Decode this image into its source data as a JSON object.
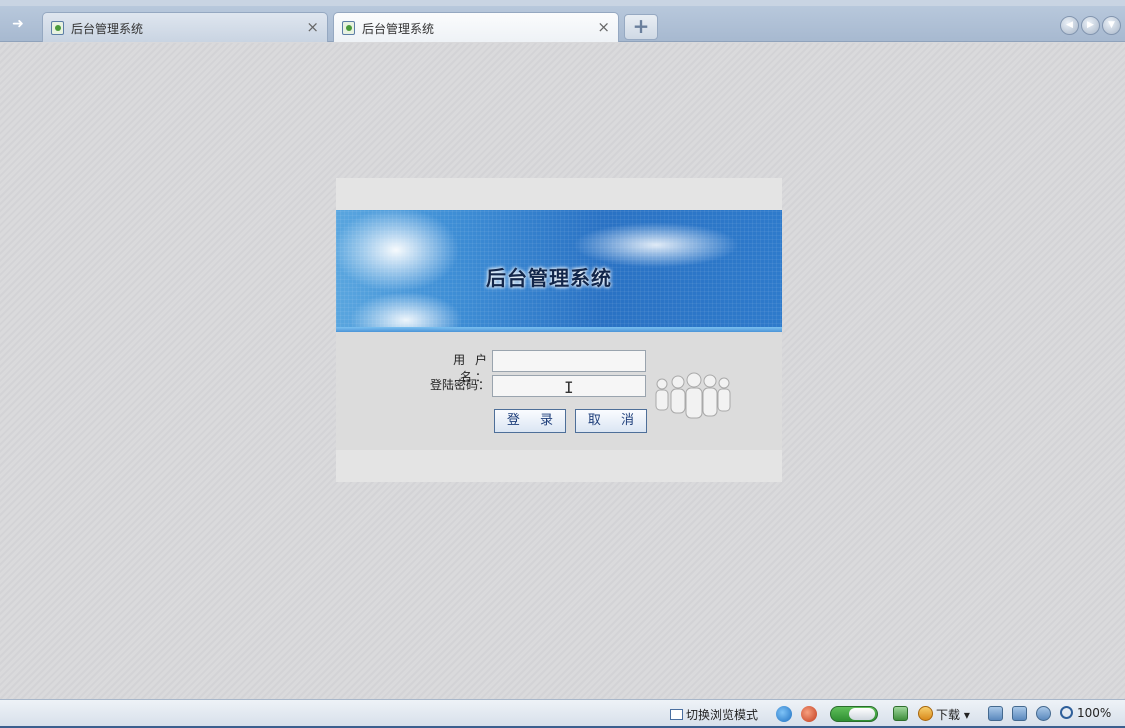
{
  "tabs": [
    {
      "label": "后台管理系统",
      "active": false
    },
    {
      "label": "后台管理系统",
      "active": true
    }
  ],
  "tab_close_glyph": "×",
  "new_tab_glyph": "+",
  "login": {
    "banner_title": "后台管理系统",
    "username_label": "用 户 名：",
    "password_label": "登陆密码：",
    "username_value": "",
    "password_value": "",
    "login_button": "登 录",
    "cancel_button": "取 消"
  },
  "statusbar": {
    "mode_switch": "切换浏览模式",
    "download": "下载 ▾",
    "zoom": "100%"
  },
  "icons": {
    "tab_menu": "arrow-right-icon",
    "tab_favicon": "page-icon",
    "people": "people-silhouette-icon"
  },
  "colors": {
    "tabbar": "#a7b9d0",
    "banner_blue": "#2a72c4",
    "button_text": "#1e3e7a"
  }
}
